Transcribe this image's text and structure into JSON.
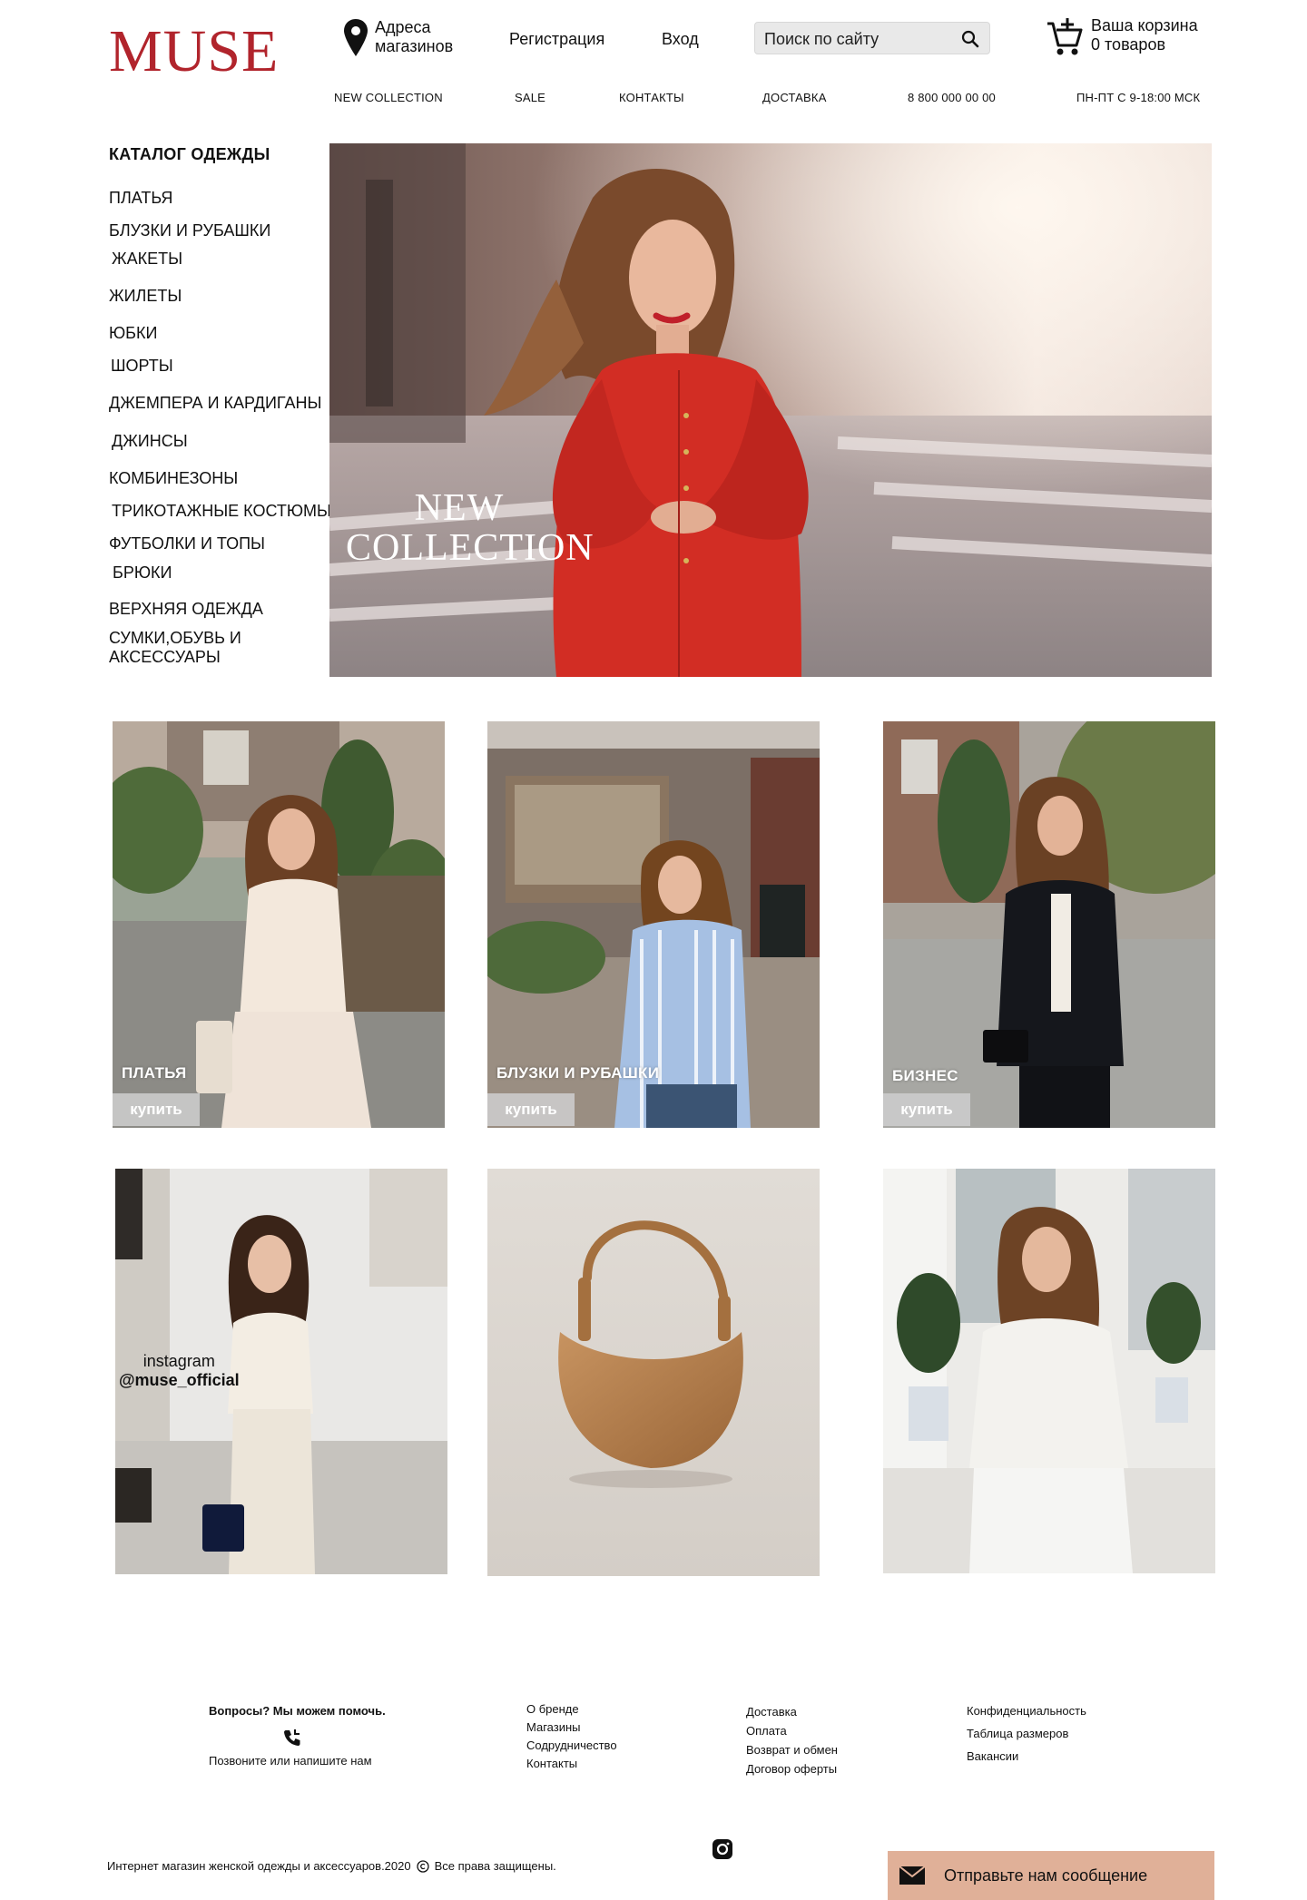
{
  "header": {
    "logo": "MUSE",
    "stores": "Адреса магазинов",
    "register": "Регистрация",
    "login": "Вход",
    "search_placeholder": "Поиск по сайту",
    "cart_title": "Ваша корзина",
    "cart_count": "0 товаров"
  },
  "nav": {
    "new_collection": "NEW COLLECTION",
    "sale": "SALE",
    "contacts": "КОНТАКТЫ",
    "delivery": "ДОСТАВКА",
    "phone": "8 800 000 00 00",
    "hours": "ПН-ПТ С 9-18:00 МСК"
  },
  "catalog": {
    "title": "КАТАЛОГ ОДЕЖДЫ",
    "items": [
      "ПЛАТЬЯ",
      "БЛУЗКИ И РУБАШКИ",
      "ЖАКЕТЫ",
      "ЖИЛЕТЫ",
      "ЮБКИ",
      "ШОРТЫ",
      "ДЖЕМПЕРА И КАРДИГАНЫ",
      "ДЖИНСЫ",
      "КОМБИНЕЗОНЫ",
      "ТРИКОТАЖНЫЕ КОСТЮМЫ",
      "ФУТБОЛКИ И ТОПЫ",
      "БРЮКИ",
      "ВЕРХНЯЯ ОДЕЖДА",
      "СУМКИ,ОБУВЬ И АКСЕССУАРЫ"
    ]
  },
  "hero": {
    "title": "NEW COLLECTION"
  },
  "tiles": [
    {
      "label": "ПЛАТЬЯ",
      "button": "купить"
    },
    {
      "label": "БЛУЗКИ И РУБАШКИ",
      "button": "купить"
    },
    {
      "label": "БИЗНЕС",
      "button": "купить"
    }
  ],
  "instagram": {
    "label": "instagram",
    "handle": "@muse_official"
  },
  "footer": {
    "help_title": "Вопросы? Мы можем помочь.",
    "help_sub": "Позвоните или напишите нам",
    "col1": [
      "О бренде",
      "Магазины",
      "Содрудничество",
      "Контакты"
    ],
    "col2": [
      "Доставка",
      "Оплата",
      "Возврат и обмен",
      "Договор оферты"
    ],
    "col3": [
      "Конфиденциальность",
      "Таблица размеров",
      "Вакансии"
    ],
    "copyright_text": "Интернет магазин женской одежды и аксессуаров.2020",
    "rights": "Все права защищены.",
    "message_button": "Отправьте нам сообщение"
  },
  "colors": {
    "brand": "#b1242c",
    "message_button_bg": "#e0b098",
    "search_bg": "#e9e9e9"
  }
}
